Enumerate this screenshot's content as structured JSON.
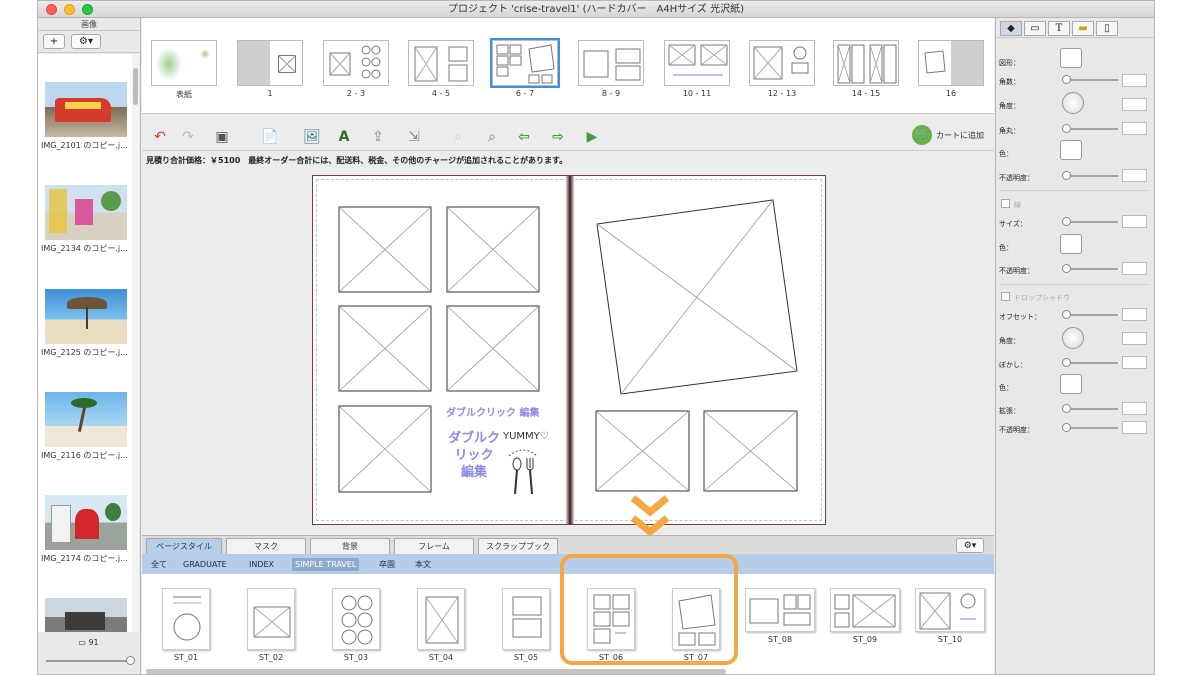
{
  "window": {
    "title": "プロジェクト 'crise-travel1' (ハードカバー　A4Hサイズ 光沢紙)"
  },
  "left": {
    "header": "画像",
    "add_label": "+",
    "gear_label": "⚙▾",
    "photos": [
      {
        "caption": "IMG_2101 のコピー.j..."
      },
      {
        "caption": "IMG_2134 のコピー.j..."
      },
      {
        "caption": "IMG_2125 のコピー.j..."
      },
      {
        "caption": "IMG_2116 のコピー.j..."
      },
      {
        "caption": "IMG_2174 のコピー.j..."
      }
    ],
    "count": "91"
  },
  "pages": [
    {
      "label": "表紙"
    },
    {
      "label": "1"
    },
    {
      "label": "2 - 3"
    },
    {
      "label": "4 - 5"
    },
    {
      "label": "6 - 7"
    },
    {
      "label": "8 - 9"
    },
    {
      "label": "10 - 11"
    },
    {
      "label": "12 - 13"
    },
    {
      "label": "14 - 15"
    },
    {
      "label": "16"
    }
  ],
  "toolbar": {
    "cart_label": "カートに追加"
  },
  "notice": "見積り合計価格：￥5100　最終オーダー合計には、配送料、税金、その他のチャージが追加されることがあります。",
  "spread": {
    "edit_hint": "ダブルクリック 編集",
    "big_text": "ダブルク\nリック\n編集",
    "yummy": "YUMMY♡"
  },
  "tabs": [
    {
      "label": "ページスタイル"
    },
    {
      "label": "マスク"
    },
    {
      "label": "背景"
    },
    {
      "label": "フレーム"
    },
    {
      "label": "スクラップブック"
    }
  ],
  "categories": [
    {
      "label": "全て"
    },
    {
      "label": "GRADUATE"
    },
    {
      "label": "INDEX"
    },
    {
      "label": "SIMPLE TRAVEL"
    },
    {
      "label": "卒園"
    },
    {
      "label": "本文"
    }
  ],
  "styles": [
    {
      "label": "ST_01"
    },
    {
      "label": "ST_02"
    },
    {
      "label": "ST_03"
    },
    {
      "label": "ST_04"
    },
    {
      "label": "ST_05"
    },
    {
      "label": "ST_06"
    },
    {
      "label": "ST_07"
    },
    {
      "label": "ST_08"
    },
    {
      "label": "ST_09"
    },
    {
      "label": "ST_10"
    }
  ],
  "inspector": {
    "shape": "図形：",
    "angles": "角数：",
    "angle": "角度：",
    "round": "角丸：",
    "color": "色：",
    "opacity": "不透明度：",
    "border_label": "線",
    "size": "サイズ：",
    "color2": "色：",
    "opacity2": "不透明度：",
    "shadow_label": "ドロップシャドウ",
    "offset": "オフセット：",
    "angle2": "角度：",
    "blur": "ぼかし：",
    "color3": "色：",
    "spread": "拡張：",
    "opacity3": "不透明度："
  },
  "colors": {
    "accent_orange": "#f5a742",
    "selected_blue": "#3d8fe0",
    "category_bar": "#b6cce8"
  }
}
